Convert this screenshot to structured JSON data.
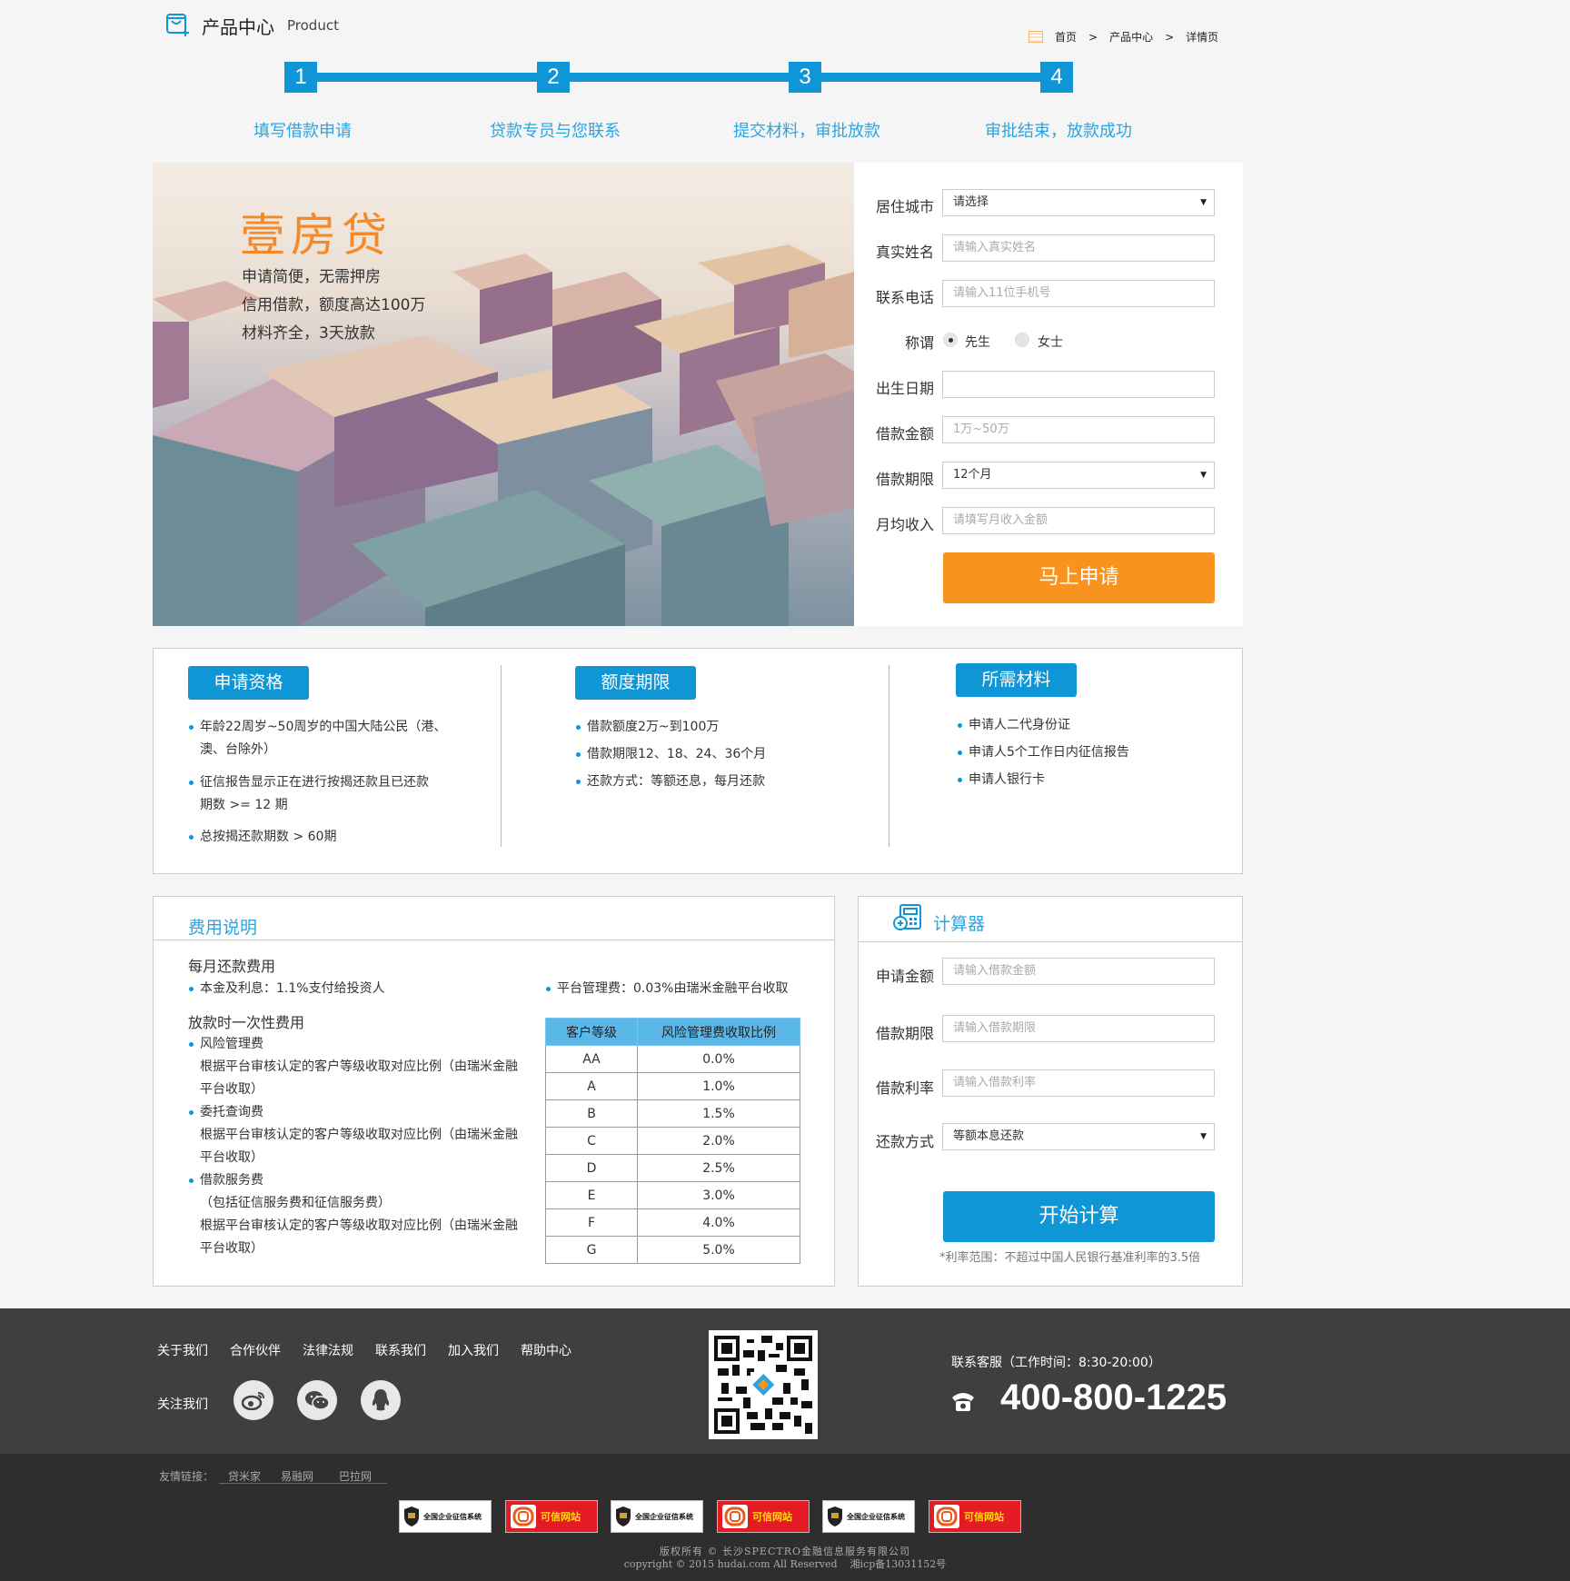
{
  "header": {
    "title": "产品中心",
    "subtitle": "Product"
  },
  "breadcrumb": [
    "首页",
    ">",
    "产品中心",
    ">",
    "详情页"
  ],
  "steps": [
    {
      "num": "1",
      "label": "填写借款申请"
    },
    {
      "num": "2",
      "label": "贷款专员与您联系"
    },
    {
      "num": "3",
      "label": "提交材料，审批放款"
    },
    {
      "num": "4",
      "label": "审批结束，放款成功"
    }
  ],
  "hero": {
    "title": "壹房贷",
    "lines": [
      "申请简便，无需押房",
      "信用借款，额度高达100万",
      "材料齐全，3天放款"
    ]
  },
  "form": {
    "city": {
      "label": "居住城市",
      "value": "请选择"
    },
    "name": {
      "label": "真实姓名",
      "placeholder": "请输入真实姓名"
    },
    "phone": {
      "label": "联系电话",
      "placeholder": "请输入11位手机号"
    },
    "title": {
      "label": "称谓",
      "options": [
        "先生",
        "女士"
      ],
      "selected": "先生"
    },
    "birth": {
      "label": "出生日期",
      "placeholder": ""
    },
    "amount": {
      "label": "借款金额",
      "placeholder": "1万~50万"
    },
    "term": {
      "label": "借款期限",
      "value": "12个月"
    },
    "income": {
      "label": "月均收入",
      "placeholder": "请填写月收入金额"
    },
    "submit": "马上申请"
  },
  "info": {
    "qualification": {
      "title": "申请资格",
      "items": [
        "年龄22周岁~50周岁的中国大陆公民（港、",
        "澳、台除外）",
        "征信报告显示正在进行按揭还款且已还款",
        "期数 >= 12 期",
        "总按揭还款期数 > 60期"
      ]
    },
    "limit": {
      "title": "额度期限",
      "items": [
        "借款额度2万~到100万",
        "借款期限12、18、24、36个月",
        "还款方式：等额还息，每月还款"
      ]
    },
    "materials": {
      "title": "所需材料",
      "items": [
        "申请人二代身份证",
        "申请人5个工作日内征信报告",
        "申请人银行卡"
      ]
    }
  },
  "fees": {
    "title": "费用说明",
    "monthly_title": "每月还款费用",
    "monthly_item": "本金及利息：1.1%支付给投资人",
    "platform_fee": "平台管理费：0.03%由瑞米金融平台收取",
    "onetime_title": "放款时一次性费用",
    "risk_title": "风险管理费",
    "risk_desc": [
      "根据平台审核认定的客户等级收取对应比例（由瑞米金融",
      "平台收取）"
    ],
    "entrust_title": "委托查询费",
    "entrust_desc": [
      "根据平台审核认定的客户等级收取对应比例（由瑞米金融",
      "平台收取）"
    ],
    "service_title": "借款服务费",
    "service_desc": [
      "（包括征信服务费和征信服务费）",
      "根据平台审核认定的客户等级收取对应比例（由瑞米金融",
      "平台收取）"
    ],
    "table": {
      "headers": [
        "客户等级",
        "风险管理费收取比例"
      ],
      "rows": [
        [
          "AA",
          "0.0%"
        ],
        [
          "A",
          "1.0%"
        ],
        [
          "B",
          "1.5%"
        ],
        [
          "C",
          "2.0%"
        ],
        [
          "D",
          "2.5%"
        ],
        [
          "E",
          "3.0%"
        ],
        [
          "F",
          "4.0%"
        ],
        [
          "G",
          "5.0%"
        ]
      ]
    }
  },
  "calculator": {
    "title": "计算器",
    "amount": {
      "label": "申请金额",
      "placeholder": "请输入借款金额"
    },
    "term": {
      "label": "借款期限",
      "placeholder": "请输入借款期限"
    },
    "rate": {
      "label": "借款利率",
      "placeholder": "请输入借款利率"
    },
    "method": {
      "label": "还款方式",
      "value": "等额本息还款"
    },
    "button": "开始计算",
    "note": "*利率范围：不超过中国人民银行基准利率的3.5倍"
  },
  "footer": {
    "links": [
      "关于我们",
      "合作伙伴",
      "法律法规",
      "联系我们",
      "加入我们",
      "帮助中心"
    ],
    "follow": "关注我们",
    "contact": "联系客服（工作时间：8:30-20:00）",
    "phone": "400-800-1225",
    "friend_label": "友情链接：",
    "friend_links": [
      "贷米家",
      "易融网",
      "巴拉网"
    ],
    "badges": [
      "全国企业征信系统",
      "可信网站",
      "全国企业征信系统",
      "可信网站",
      "全国企业征信系统",
      "可信网站"
    ],
    "copyright1": "版权所有 © 长沙SPECTRO金融信息服务有限公司",
    "copyright2": "copyright © 2015 hudai.com All Reserved    湘icp备13031152号"
  },
  "colors": {
    "primary": "#0f96d6",
    "accent": "#f7931e",
    "footer": "#3f3f3f"
  }
}
